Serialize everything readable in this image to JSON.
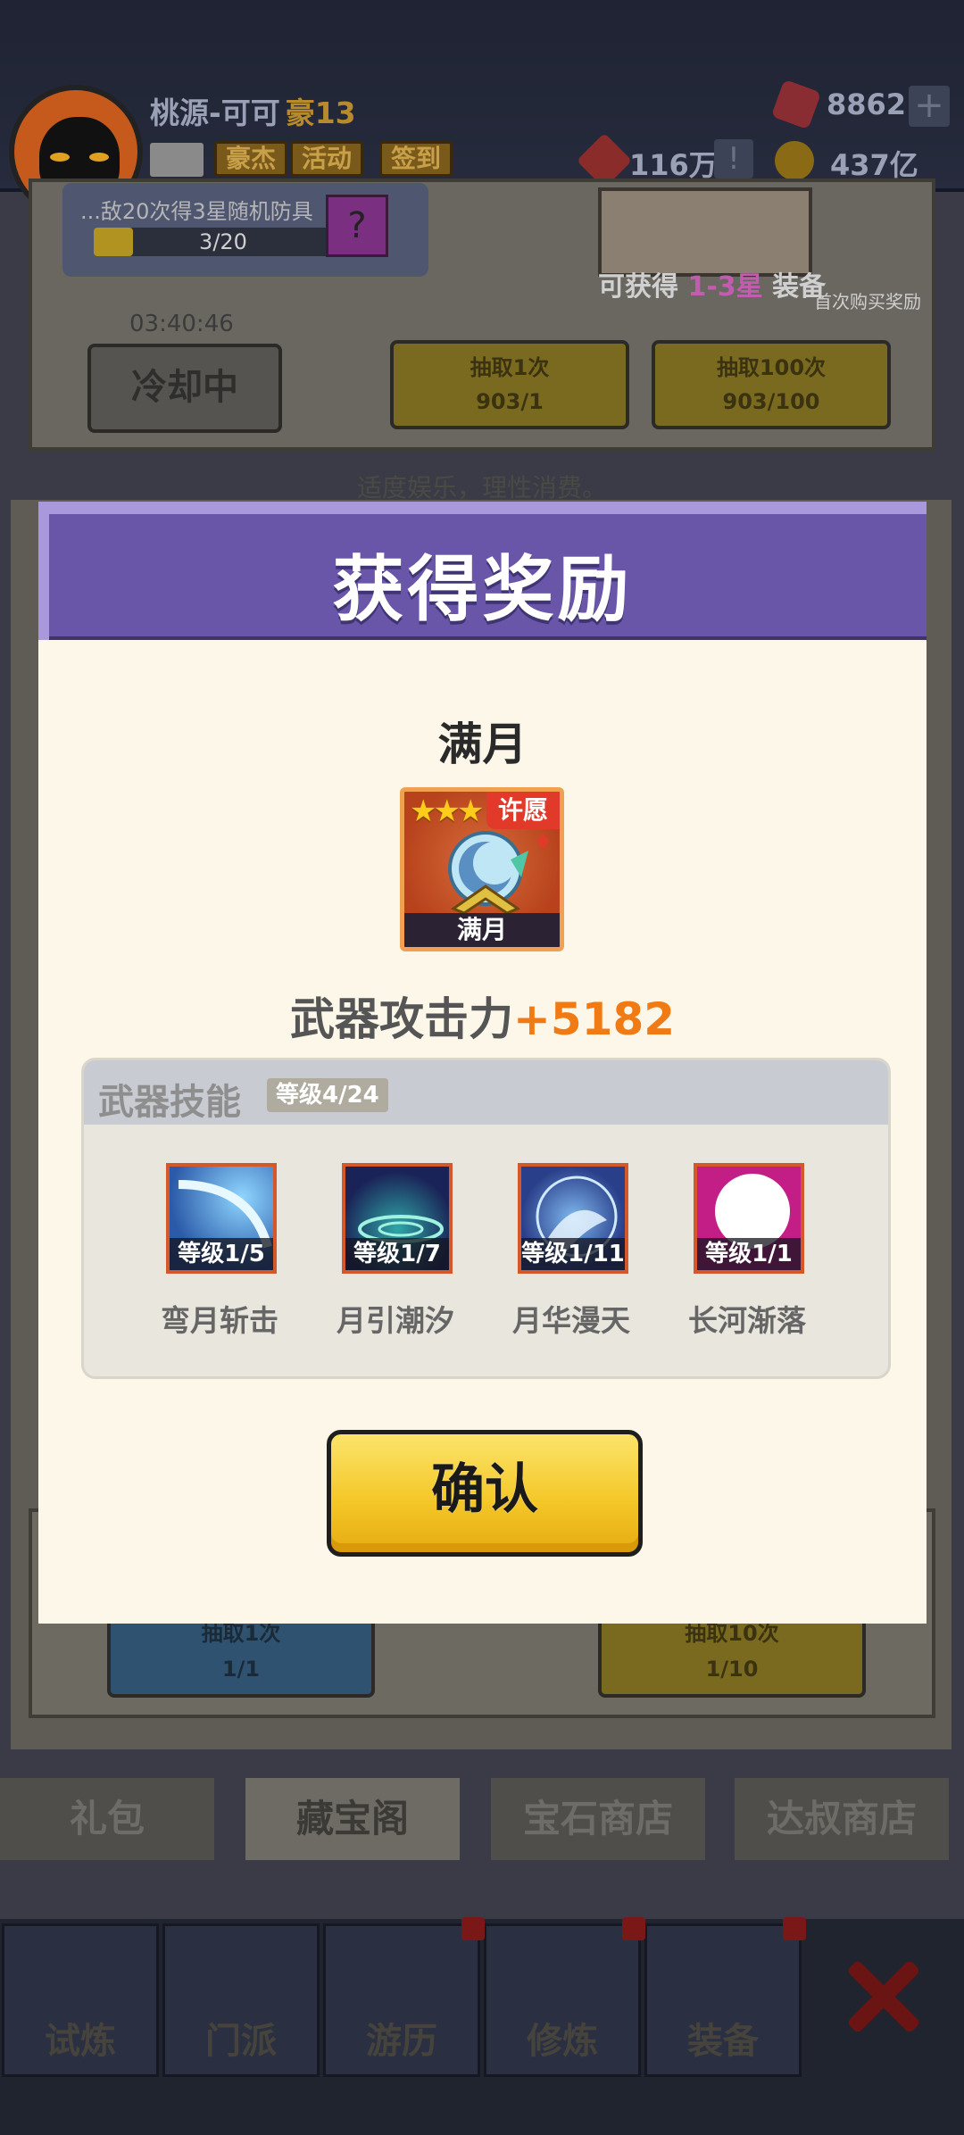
{
  "player": {
    "name": "桃源-可可",
    "rank": "豪13"
  },
  "top_buttons": {
    "hero": "豪杰",
    "activity": "活动",
    "checkin": "签到"
  },
  "resources": {
    "gems": "8862",
    "tokens": "116万",
    "coins": "437亿"
  },
  "shop": {
    "progress_text": "...敌20次得3星随机防具",
    "progress_value": "3/20",
    "progress_fraction": 0.15,
    "can_gain_prefix": "可获得",
    "can_gain_stars": "1-3星",
    "can_gain_suffix": "装备",
    "first_buy": "首次购买奖励",
    "timer": "03:40:46",
    "cooldown": "冷却中",
    "draw1": {
      "label": "抽取1次",
      "cost": "903/1"
    },
    "draw100": {
      "label": "抽取100次",
      "cost": "903/100"
    },
    "slogan": "适度娱乐，理性消费。"
  },
  "lower_card": {
    "draw1": {
      "label": "抽取1次",
      "cost": "1/1"
    },
    "draw10": {
      "label": "抽取10次",
      "cost": "1/10"
    }
  },
  "bottom_tabs": [
    "礼包",
    "藏宝阁",
    "宝石商店",
    "达叔商店"
  ],
  "nav": [
    "试炼",
    "门派",
    "游历",
    "修炼",
    "装备"
  ],
  "modal": {
    "title": "获得奖励",
    "item_name": "满月",
    "item_card_label": "满月",
    "item_stars": "★★★",
    "item_tag": "许愿",
    "attack_label": "武器攻击力",
    "attack_value": "+5182",
    "skills_title": "武器技能",
    "skills_level": "等级4/24",
    "skills": [
      {
        "name": "弯月斩击",
        "level": "等级1/5"
      },
      {
        "name": "月引潮汐",
        "level": "等级1/7"
      },
      {
        "name": "月华漫天",
        "level": "等级1/11"
      },
      {
        "name": "长河渐落",
        "level": "等级1/1"
      }
    ],
    "confirm": "确认"
  },
  "colors": {
    "header": "#6a56a8",
    "accent": "#f07a14",
    "confirm": "#f5c82a"
  }
}
